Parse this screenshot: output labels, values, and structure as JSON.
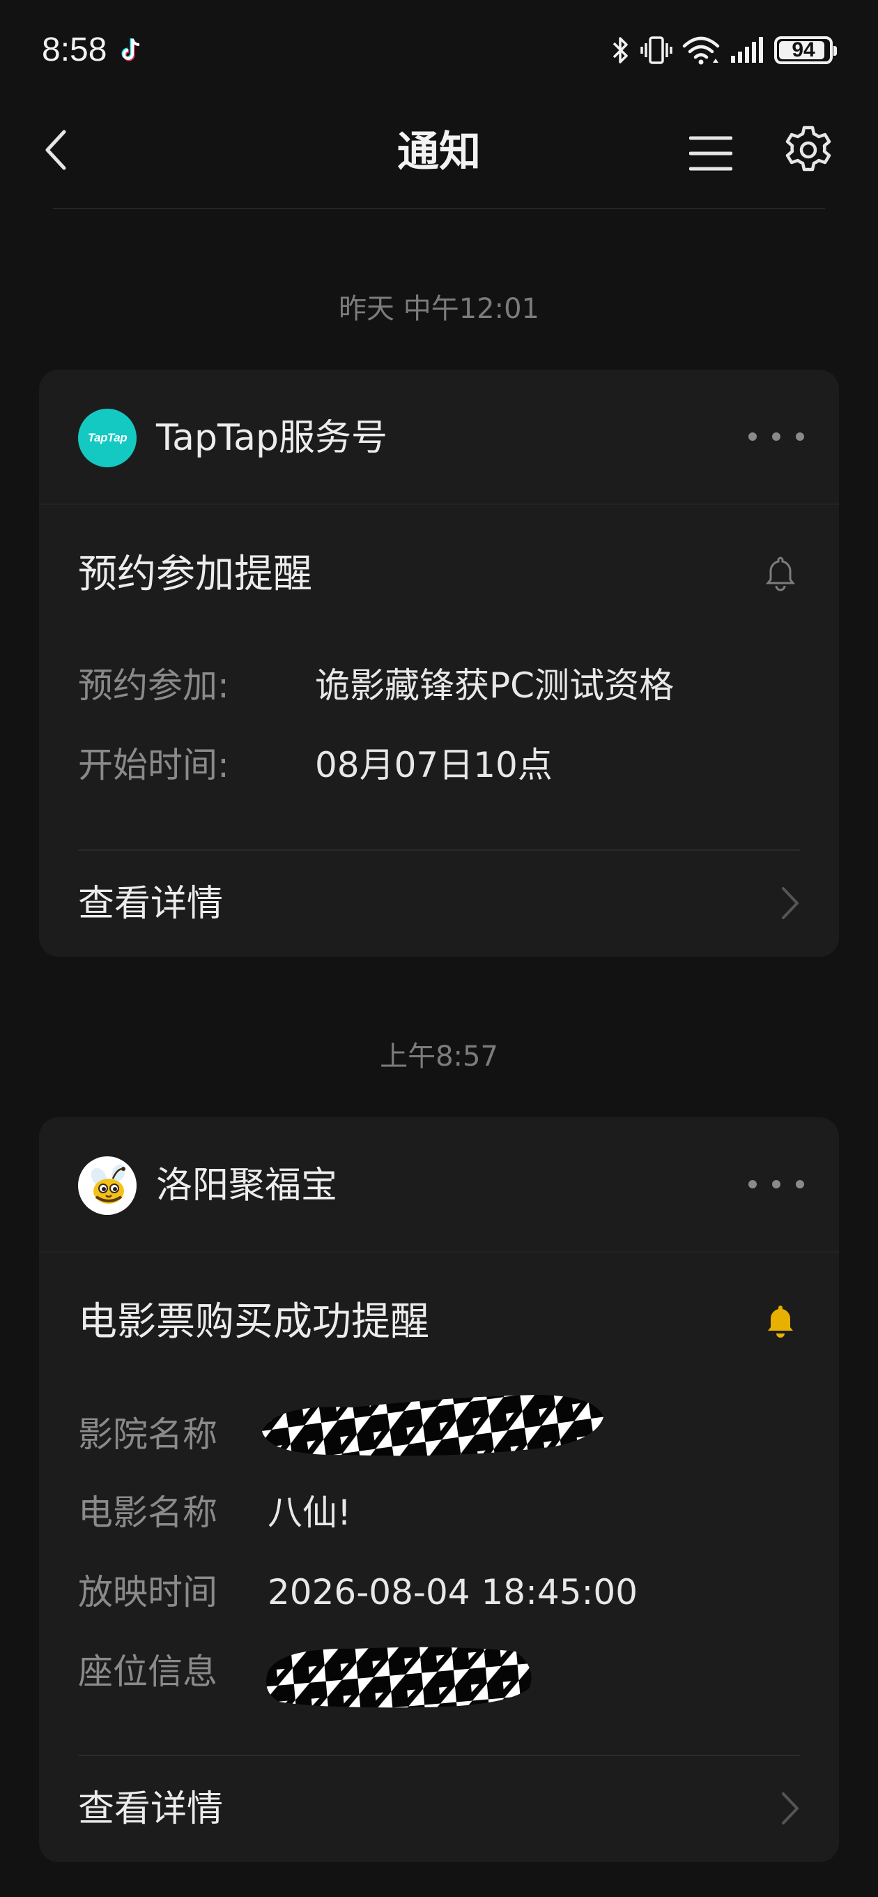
{
  "status_bar": {
    "time": "8:58",
    "battery_level": "94",
    "battery_fraction": 0.94,
    "icons": [
      "tiktok-icon",
      "bluetooth-icon",
      "vibrate-icon",
      "wifi-icon",
      "signal-icon",
      "battery-icon"
    ]
  },
  "nav": {
    "title": "通知",
    "icons": [
      "back-icon",
      "menu-icon",
      "settings-icon"
    ]
  },
  "notifications": [
    {
      "timestamp": "昨天 中午12:01",
      "sender": "TapTap服务号",
      "avatar_text": "TapTap",
      "avatar_color": "#14c9c1",
      "title": "预约参加提醒",
      "bell_active": false,
      "fields": [
        {
          "label": "预约参加:",
          "value": "诡影藏锋获PC测试资格"
        },
        {
          "label": "开始时间:",
          "value": "08月07日10点"
        }
      ],
      "detail_label": "查看详情"
    },
    {
      "timestamp": "上午8:57",
      "sender": "洛阳聚福宝",
      "avatar_icon": "bee-mascot-icon",
      "title": "电影票购买成功提醒",
      "bell_active": true,
      "bell_color": "#e8b000",
      "fields": [
        {
          "label": "影院名称",
          "value": ""
        },
        {
          "label": "电影名称",
          "value": "八仙!"
        },
        {
          "label": "放映时间",
          "value": "2026-08-04 18:45:00"
        },
        {
          "label": "座位信息",
          "value": ""
        }
      ],
      "detail_label": "查看详情"
    }
  ]
}
